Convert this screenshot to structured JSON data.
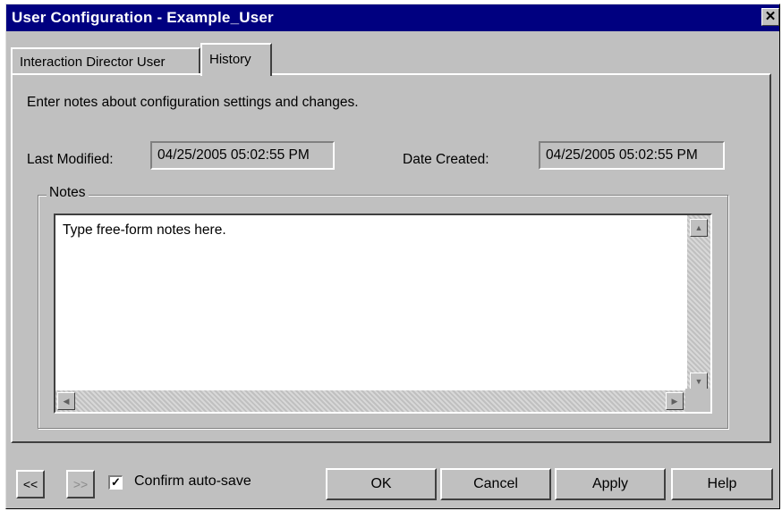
{
  "window": {
    "title": "User Configuration - Example_User",
    "close_glyph": "✕"
  },
  "tabs": [
    {
      "label": "Interaction Director User",
      "selected": false
    },
    {
      "label": "History",
      "selected": true
    }
  ],
  "history": {
    "instruction": "Enter notes about configuration settings and changes.",
    "last_modified_label": "Last Modified:",
    "last_modified_value": "04/25/2005 05:02:55 PM",
    "date_created_label": "Date Created:",
    "date_created_value": "04/25/2005 05:02:55 PM",
    "notes_group_label": "Notes",
    "notes_text": "Type free-form notes here."
  },
  "scrollbar": {
    "up": "▲",
    "down": "▼",
    "left": "◀",
    "right": "▶"
  },
  "footer": {
    "prev_label": "<<",
    "next_label": ">>",
    "confirm_autosave_label": "Confirm auto-save",
    "confirm_autosave_checked": true,
    "check_glyph": "✓",
    "ok_label": "OK",
    "cancel_label": "Cancel",
    "apply_label": "Apply",
    "help_label": "Help"
  }
}
